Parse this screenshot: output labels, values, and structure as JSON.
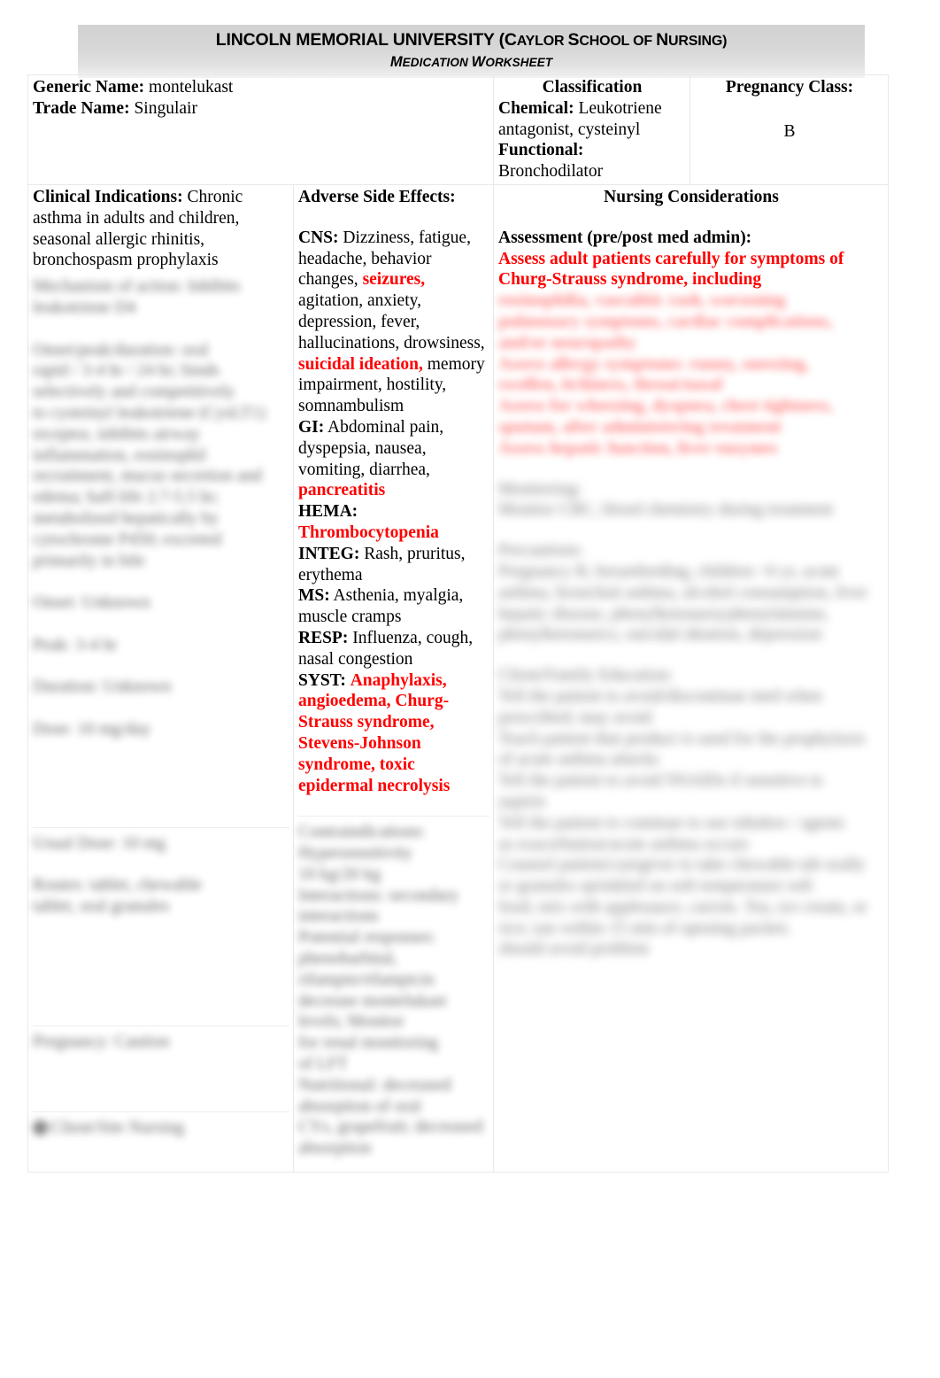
{
  "header": {
    "institution_line": "LINCOLN MEMORIAL UNIVERSITY (CAYLOR SCHOOL OF NURSING)",
    "institution_main": "LINCOLN MEMORIAL UNIVERSITY (",
    "institution_sc1": "C",
    "institution_sc1_rest": "AYLOR ",
    "institution_sc2": "S",
    "institution_sc2_rest": "CHOOL OF ",
    "institution_sc3": "N",
    "institution_sc3_rest": "URSING)",
    "doc_title": "MEDICATION WORKSHEET",
    "doc_title_m": "M",
    "doc_title_rest1": "EDICATION ",
    "doc_title_w": "W",
    "doc_title_rest2": "ORKSHEET"
  },
  "identity": {
    "generic_label": "Generic Name:",
    "generic_value": "montelukast",
    "trade_label": "Trade Name:",
    "trade_value": "Singulair"
  },
  "classification": {
    "heading": "Classification",
    "chemical_label": "Chemical:",
    "chemical_value": "Leukotriene antagonist, cysteinyl",
    "functional_label": "Functional:",
    "functional_value": "Bronchodilator"
  },
  "pregnancy": {
    "label": "Pregnancy Class:",
    "value": "B"
  },
  "clinical_indications": {
    "label": "Clinical Indications:",
    "value": "Chronic asthma in adults and children, seasonal allergic rhinitis, bronchospasm prophylaxis",
    "obscured_lines": [
      "Mechanism of action:  Inhibits",
      "leukotriene D4",
      "Onset/peak/duration: oral",
      "rapid / 3-4 hr / 24 hr;  binds",
      "selectively  and  competitively",
      "to  cysteinyl  leukotriene  (CysLT1)",
      "receptor, inhibits airway",
      "inflammation, eosinophil",
      "recruitment, mucus secretion and",
      "edema; half-life 2.7-5.5 hr;",
      "metabolized hepatically by",
      "cytochrome P450; excreted",
      "primarily in bile",
      "Onset:  Unknown",
      "Peak:  3-4 hr",
      "Duration:  Unknown",
      "Dose:  10 mg/day"
    ],
    "obscured_lines_b": [
      "Usual Dose:  10 mg",
      "Routes:  tablet, chewable",
      "tablet, oral granules"
    ],
    "obscured_lines_c": [
      "Pregnancy:  Caution"
    ],
    "obscured_footer": "Client/Site Nursing"
  },
  "adverse_effects": {
    "heading": "Adverse Side Effects:",
    "groups": [
      {
        "label": "CNS:",
        "segments": [
          {
            "text": " Dizziness, fatigue, headache, behavior changes, ",
            "red": false
          },
          {
            "text": "seizures,",
            "red": true
          },
          {
            "text": " agitation, anxiety, depression, fever, hallucinations, drowsiness, ",
            "red": false
          },
          {
            "text": "suicidal ideation,",
            "red": true
          },
          {
            "text": " memory impairment, hostility, somnambulism",
            "red": false
          }
        ]
      },
      {
        "label": "GI:",
        "segments": [
          {
            "text": " Abdominal pain, dyspepsia, nausea, vomiting, diarrhea, ",
            "red": false
          },
          {
            "text": "pancreatitis",
            "red": true
          }
        ]
      },
      {
        "label": "HEMA:",
        "segments": [
          {
            "text": " ",
            "red": false
          },
          {
            "text": "Thrombocytopenia",
            "red": true
          }
        ]
      },
      {
        "label": "INTEG:",
        "segments": [
          {
            "text": " Rash, pruritus, erythema",
            "red": false
          }
        ]
      },
      {
        "label": "MS:",
        "segments": [
          {
            "text": " Asthenia, myalgia, muscle cramps",
            "red": false
          }
        ]
      },
      {
        "label": "RESP:",
        "segments": [
          {
            "text": " Influenza, cough, nasal congestion",
            "red": false
          }
        ]
      },
      {
        "label": "SYST:",
        "segments": [
          {
            "text": " ",
            "red": false
          },
          {
            "text": "Anaphylaxis, angioedema, Churg-Strauss syndrome, Stevens-Johnson syndrome, toxic epidermal necrolysis",
            "red": true
          }
        ]
      }
    ],
    "obscured_lines": [
      "Contraindications:",
      "Hypersensitivity",
      "10 kg/20 kg",
      "Interactions:  secondary",
      "interactions",
      "Potential  responses:",
      "phenobarbital,",
      "rifampin/rifampicin",
      "decrease  montelukast",
      "levels;  Monitor",
      "for renal monitoring",
      "of LFT",
      "Nutritional:  decreased",
      "absorption of oral",
      "CYs, grapefruit; decreased",
      "absorption"
    ]
  },
  "nursing": {
    "heading": "Nursing Considerations",
    "assessment_label": "Assessment (pre/post med admin):",
    "assessment_red": "Assess adult patients carefully for symptoms of Churg-Strauss syndrome, including",
    "assessment_red_obscured": [
      "eosinophilia, vasculitic rash, worsening",
      "pulmonary symptoms, cardiac complications,",
      "and/or neuropathy",
      "Assess allergy symptoms: runny, sneezing,",
      "swollen, itchiness, throat/nasal",
      "Assess for wheezing, dyspnea, chest tightness,",
      "sputum, after administering treatment",
      "Assess hepatic function, liver enzymes"
    ],
    "monitoring_obscured": [
      "Monitoring:",
      "Monitor CBC, blood chemistry during treatment"
    ],
    "precautions_obscured": [
      "Precautions:",
      "Pregnancy B, breastfeeding, children <6 yr, acute",
      "asthma, bronchial asthma, alcohol consumption, liver",
      "hepatic disease,  phenylketonuria/phenylalanine,",
      "phenylketonurics, suicidal ideation, depression"
    ],
    "teaching_obscured": [
      "Client/Family Education:",
      "Tell the patient to avoid/discontinue med when",
      "prescribed; may avoid",
      "Teach patient that product is used for the prophylaxis",
      "of acute asthma attacks",
      "Tell the patient to avoid NSAIDs if sensitive to",
      "aspirin",
      "Tell the patient to continue to use inhalers / agents",
      "as exacerbation/acute asthma occurs",
      "Counsel  patient/caregiver to take chewable tab orally",
      "or granules  sprinkled  on soft  temperature soft",
      "food, mix with applesauce, carrots. Tea, ice cream, or",
      "rice; use within 15 min of opening packet;",
      "should avoid problem"
    ]
  },
  "colors": {
    "alert_red": "#ff0000",
    "banner_gray": "#d5d5d5",
    "border_gray": "#e9e9e9"
  }
}
